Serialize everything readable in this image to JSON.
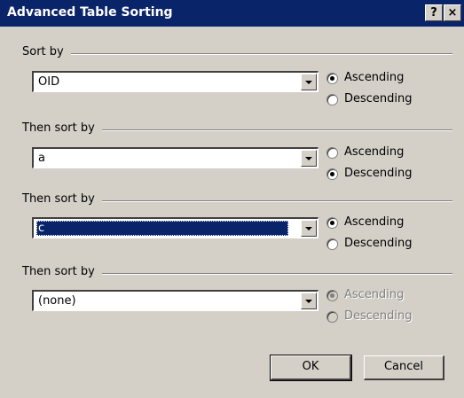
{
  "window": {
    "title": "Advanced Table Sorting",
    "help_glyph": "?",
    "close_glyph": "×"
  },
  "groups": [
    {
      "label": "Sort by",
      "value": "OID",
      "selected": false,
      "ascending": "Ascending",
      "descending": "Descending",
      "checked": "ascending",
      "disabled": false
    },
    {
      "label": "Then sort by",
      "value": "a",
      "selected": false,
      "ascending": "Ascending",
      "descending": "Descending",
      "checked": "descending",
      "disabled": false
    },
    {
      "label": "Then sort by",
      "value": "c",
      "selected": true,
      "ascending": "Ascending",
      "descending": "Descending",
      "checked": "ascending",
      "disabled": false
    },
    {
      "label": "Then sort by",
      "value": "(none)",
      "selected": false,
      "ascending": "Ascending",
      "descending": "Descending",
      "checked": "ascending",
      "disabled": true
    }
  ],
  "buttons": {
    "ok": "OK",
    "cancel": "Cancel"
  }
}
